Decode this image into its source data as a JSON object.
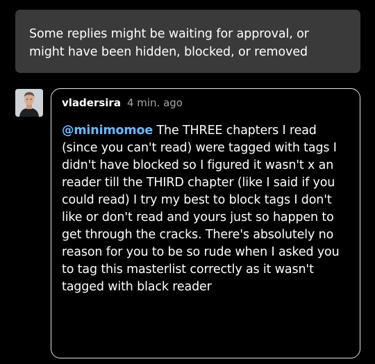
{
  "notice": {
    "text": "Some replies might be waiting for approval, or might have been hidden, blocked, or removed"
  },
  "reply": {
    "avatar_icon": "user-avatar-photo",
    "username": "vladersira",
    "timestamp": "4 min. ago",
    "mention": "@minimomoe",
    "body": "The THREE chapters I read (since you can't read) were tagged with tags I didn't have blocked so I figured it wasn't x an reader till the THIRD chapter (like I said if you could read) I try my best to block tags I don't like or don't read and yours just so happen to get through the cracks. There's absolutely no reason for you to be so rude when I asked you to tag this masterlist correctly as it wasn't tagged with black reader"
  },
  "colors": {
    "background": "#000000",
    "notice_bg": "#3a3a3a",
    "mention": "#6fb6ff",
    "timestamp": "#a6a6a6",
    "card_border": "#e6e6e6"
  }
}
